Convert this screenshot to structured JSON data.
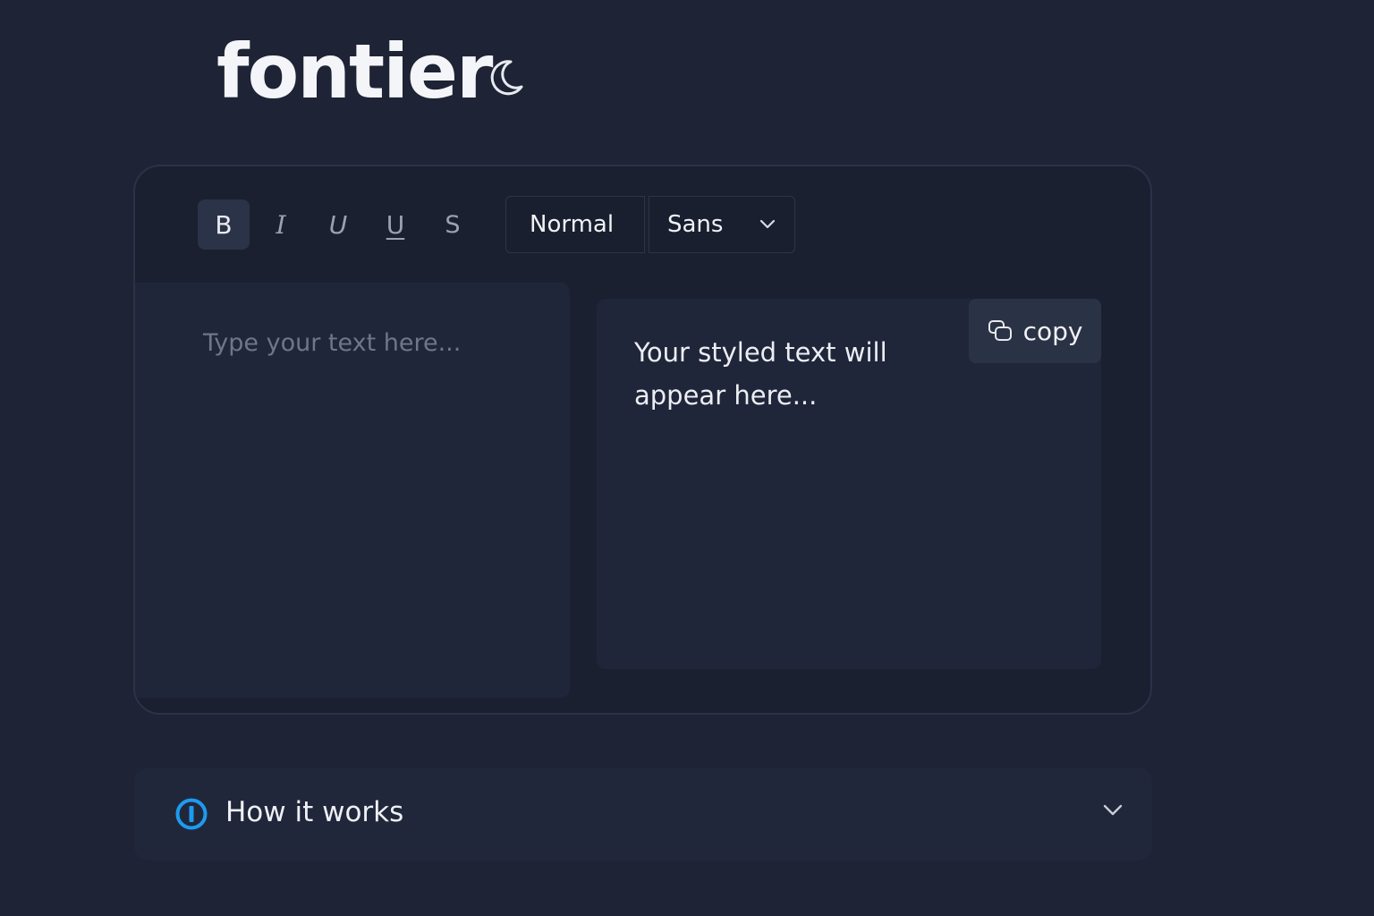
{
  "app": {
    "logo": "fontier",
    "theme_toggle_icon": "moon-icon"
  },
  "toolbar": {
    "bold": "B",
    "italic": "I",
    "italic_underline": "U",
    "underline": "U",
    "strikethrough": "S",
    "size_select": "Normal",
    "font_select": "Sans",
    "dropdown_icon": "chevron-down-icon"
  },
  "input": {
    "placeholder": "Type your text here..."
  },
  "output": {
    "placeholder": "Your styled text will appear here...",
    "copy_label": "copy",
    "copy_icon": "copy-icon"
  },
  "help": {
    "title": "How it works",
    "info_icon": "info-icon",
    "expand_icon": "chevron-down-icon"
  },
  "colors": {
    "background": "#1e2335",
    "accent": "#1d9bf0",
    "panel": "#20263a"
  }
}
